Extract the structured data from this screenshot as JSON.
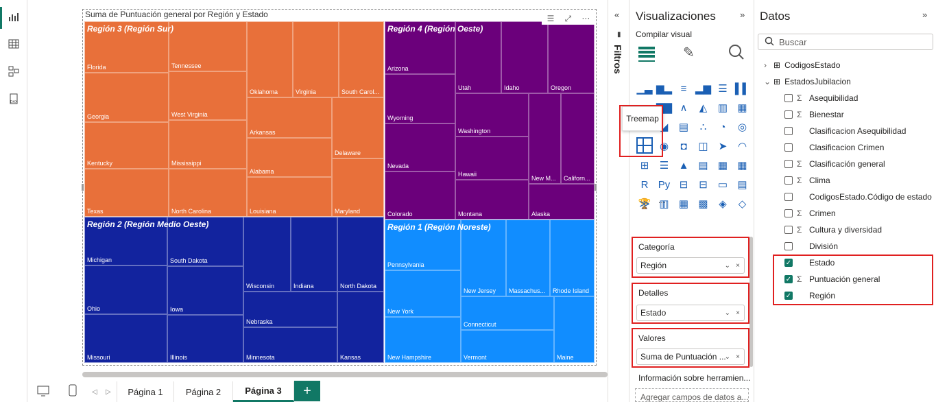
{
  "visual": {
    "title": "Suma de Puntuación general por Región y Estado"
  },
  "treemap": {
    "groups": [
      {
        "label": "Región 3 (Región Sur)",
        "color": "#e8703a"
      },
      {
        "label": "Región 4 (Región Oeste)",
        "color": "#6b007b"
      },
      {
        "label": "Región 2 (Región Medio Oeste)",
        "color": "#12239e"
      },
      {
        "label": "Región 1 (Región Noreste)",
        "color": "#118dff"
      }
    ],
    "states": [
      "Florida",
      "Tennessee",
      "Georgia",
      "West Virginia",
      "Oklahoma",
      "Virginia",
      "South Carol...",
      "Arkansas",
      "Delaware",
      "Kentucky",
      "Mississippi",
      "Alabama",
      "Texas",
      "North Carolina",
      "Louisiana",
      "Maryland",
      "Arizona",
      "Utah",
      "Idaho",
      "Oregon",
      "Wyoming",
      "Washington",
      "Nevada",
      "Hawaii",
      "New M...",
      "Californ...",
      "Colorado",
      "Montana",
      "Alaska",
      "Michigan",
      "South Dakota",
      "Ohio",
      "Iowa",
      "Wisconsin",
      "Indiana",
      "North Dakota",
      "Nebraska",
      "Missouri",
      "Illinois",
      "Minnesota",
      "Kansas",
      "Pennsylvania",
      "New Jersey",
      "Massachus...",
      "Rhode Island",
      "New York",
      "Connecticut",
      "New Hampshire",
      "Vermont",
      "Maine"
    ]
  },
  "tabs": {
    "page1": "Página 1",
    "page2": "Página 2",
    "page3": "Página 3",
    "add": "+"
  },
  "filters": {
    "label": "Filtros"
  },
  "viz": {
    "title": "Visualizaciones",
    "subtitle": "Compilar visual",
    "tooltip": "Treemap",
    "more": "...",
    "wells": {
      "categoria_label": "Categoría",
      "categoria_value": "Región",
      "detalles_label": "Detalles",
      "detalles_value": "Estado",
      "valores_label": "Valores",
      "valores_value": "Suma de Puntuación ..."
    },
    "info": "Información sobre herramien...",
    "add_fields": "Agregar campos de datos a..."
  },
  "datos": {
    "title": "Datos",
    "search_placeholder": "Buscar",
    "tables": [
      "CodigosEstado",
      "EstadosJubilacion"
    ],
    "fields": [
      {
        "name": "Asequibilidad",
        "sigma": true,
        "checked": false
      },
      {
        "name": "Bienestar",
        "sigma": true,
        "checked": false
      },
      {
        "name": "Clasificacion Asequibilidad",
        "sigma": false,
        "checked": false
      },
      {
        "name": "Clasificacion Crimen",
        "sigma": false,
        "checked": false
      },
      {
        "name": "Clasificación general",
        "sigma": true,
        "checked": false
      },
      {
        "name": "Clima",
        "sigma": true,
        "checked": false
      },
      {
        "name": "CodigosEstado.Código de estado",
        "sigma": false,
        "checked": false
      },
      {
        "name": "Crimen",
        "sigma": true,
        "checked": false
      },
      {
        "name": "Cultura y diversidad",
        "sigma": true,
        "checked": false
      },
      {
        "name": "División",
        "sigma": false,
        "checked": false
      },
      {
        "name": "Estado",
        "sigma": false,
        "checked": true
      },
      {
        "name": "Puntuación general",
        "sigma": true,
        "checked": true
      },
      {
        "name": "Región",
        "sigma": false,
        "checked": true
      }
    ]
  }
}
